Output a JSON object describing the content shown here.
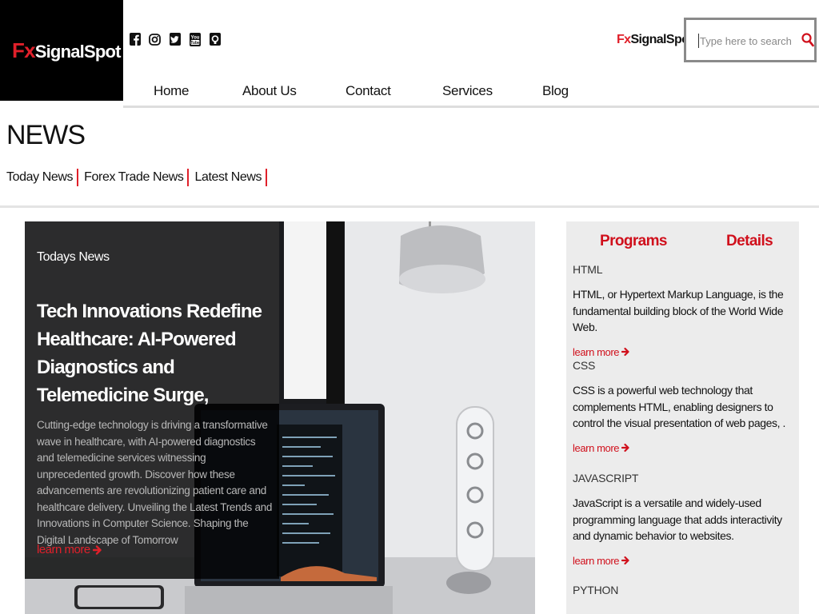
{
  "header": {
    "logo_prefix": "Fx",
    "logo_rest": "SignalSpot",
    "brand_prefix": "Fx",
    "brand_rest": "SignalSpot",
    "search_placeholder": "Type here to search",
    "social_icons": [
      "facebook-icon",
      "instagram-icon",
      "twitter-icon",
      "youtube-icon",
      "github-icon"
    ]
  },
  "nav": {
    "items": [
      "Home",
      "About Us",
      "Contact",
      "Services",
      "Blog"
    ]
  },
  "news": {
    "title": "NEWS",
    "tabs": [
      "Today News",
      "Forex Trade News",
      "Latest News"
    ]
  },
  "hero": {
    "kicker": "Todays News",
    "headline": "Tech Innovations Redefine Healthcare: AI-Powered Diagnostics and Telemedicine Surge,",
    "body": "Cutting-edge technology is driving a transformative wave in healthcare, with AI-powered diagnostics and telemedicine services witnessing unprecedented growth. Discover how these advancements are revolutionizing patient care and healthcare delivery. Unveiling the Latest Trends and Innovations in Computer Science. Shaping the Digital Landscape of Tomorrow",
    "link": "learn more"
  },
  "sidebar": {
    "headers": [
      "Programs",
      "Details"
    ],
    "entries": [
      {
        "name": "HTML",
        "desc": "HTML, or Hypertext Markup Language, is the fundamental building block of the World Wide Web.",
        "link": "learn more"
      },
      {
        "name": "CSS",
        "desc": "CSS is a powerful web technology that complements HTML, enabling designers to control the visual presentation of web pages, .",
        "link": "learn more"
      },
      {
        "name": "JAVASCRIPT",
        "desc": "JavaScript is a versatile and widely-used programming language that adds interactivity and dynamic behavior to websites.",
        "link": "learn more"
      },
      {
        "name": "PYTHON",
        "desc": "",
        "link": ""
      }
    ]
  },
  "colors": {
    "accent": "#e0202a",
    "logo_bg": "#000000",
    "sidebar_bg": "#ececec"
  }
}
